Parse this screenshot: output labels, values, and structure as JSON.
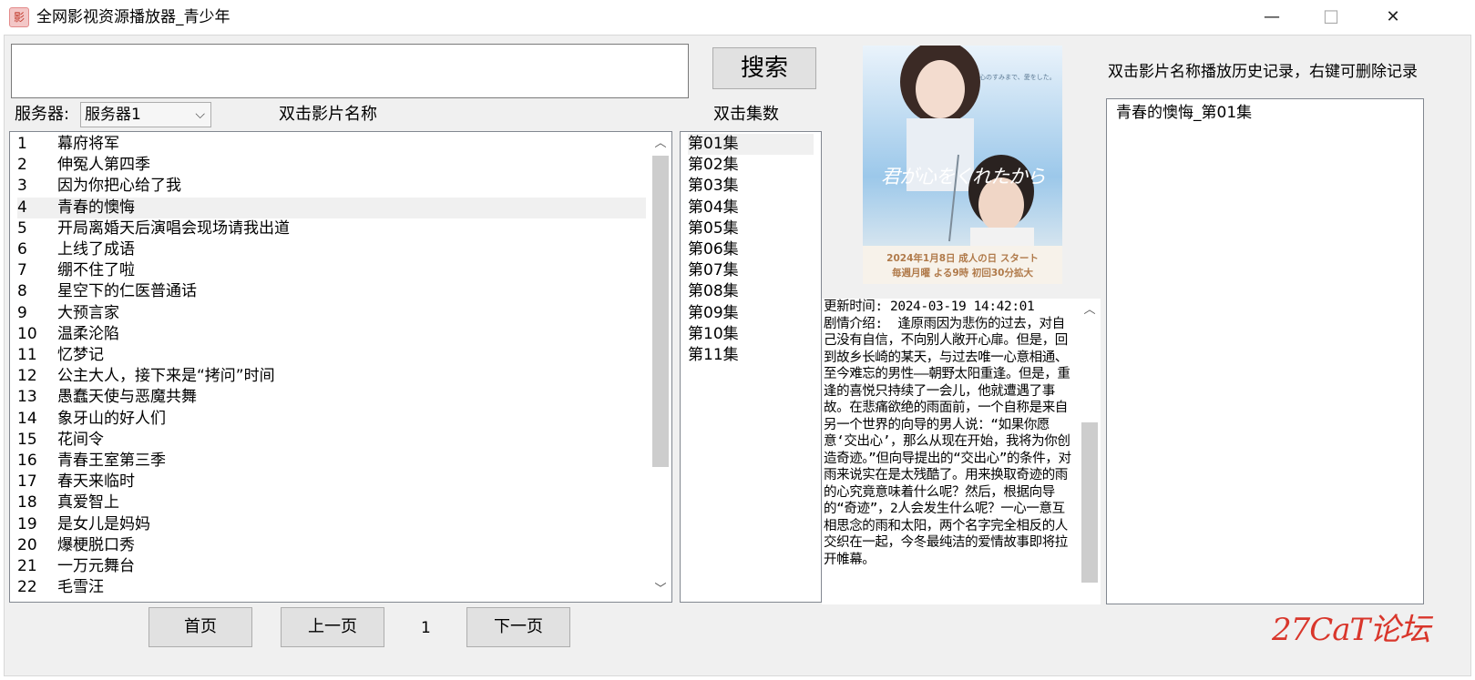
{
  "window": {
    "title": "全网影视资源播放器_青少年",
    "icon": "app-logo-icon",
    "controls": {
      "minimize": "—",
      "maximize": "☐",
      "close": "✕"
    }
  },
  "search": {
    "value": "",
    "button_label": "搜索"
  },
  "server": {
    "label": "服务器:",
    "selected": "服务器1"
  },
  "movie_list": {
    "header": "双击影片名称",
    "selected_index": 3,
    "items": [
      {
        "num": "1",
        "title": "幕府将军"
      },
      {
        "num": "2",
        "title": "伸冤人第四季"
      },
      {
        "num": "3",
        "title": "因为你把心给了我"
      },
      {
        "num": "4",
        "title": "青春的懊悔"
      },
      {
        "num": "5",
        "title": "开局离婚天后演唱会现场请我出道"
      },
      {
        "num": "6",
        "title": "上线了成语"
      },
      {
        "num": "7",
        "title": "绷不住了啦"
      },
      {
        "num": "8",
        "title": "星空下的仁医普通话"
      },
      {
        "num": "9",
        "title": "大预言家"
      },
      {
        "num": "10",
        "title": "温柔沦陷"
      },
      {
        "num": "11",
        "title": "忆梦记"
      },
      {
        "num": "12",
        "title": "公主大人，接下来是“拷问”时间"
      },
      {
        "num": "13",
        "title": "愚蠢天使与恶魔共舞"
      },
      {
        "num": "14",
        "title": "象牙山的好人们"
      },
      {
        "num": "15",
        "title": "花间令"
      },
      {
        "num": "16",
        "title": "青春王室第三季"
      },
      {
        "num": "17",
        "title": "春天来临时"
      },
      {
        "num": "18",
        "title": "真爱智上"
      },
      {
        "num": "19",
        "title": "是女儿是妈妈"
      },
      {
        "num": "20",
        "title": "爆梗脱口秀"
      },
      {
        "num": "21",
        "title": "一万元舞台"
      },
      {
        "num": "22",
        "title": "毛雪汪"
      }
    ]
  },
  "episode_list": {
    "header": "双击集数",
    "selected_index": 0,
    "items": [
      "第01集",
      "第02集",
      "第03集",
      "第04集",
      "第05集",
      "第06集",
      "第07集",
      "第08集",
      "第09集",
      "第10集",
      "第11集"
    ]
  },
  "poster": {
    "title_text": "君が心をくれたから",
    "tagline": "心のすみまで、愛をした。",
    "line1": "2024年1月8日 成人の日 スタート",
    "line2": "毎週月曜 よる9時 初回30分拡大"
  },
  "description": {
    "text": "更新时间: 2024-03-19 14:42:01\n剧情介绍:  逢原雨因为悲伤的过去，对自己没有自信，不向别人敞开心扉。但是，回到故乡长崎的某天，与过去唯一心意相通、至今难忘的男性——朝野太阳重逢。但是，重逢的喜悦只持续了一会儿，他就遭遇了事故。在悲痛欲绝的雨面前，一个自称是来自另一个世界的向导的男人说：“如果你愿意‘交出心’，那么从现在开始，我将为你创造奇迹。”但向导提出的“交出心”的条件，对雨来说实在是太残酷了。用来换取奇迹的雨的心究竟意味着什么呢？然后，根据向导的“奇迹”，2人会发生什么呢？一心一意互相思念的雨和太阳，两个名字完全相反的人交织在一起，今冬最纯洁的爱情故事即将拉开帷幕。"
  },
  "history": {
    "header": "双击影片名称播放历史记录，右键可删除记录",
    "items": [
      "青春的懊悔_第01集"
    ]
  },
  "pagination": {
    "first": "首页",
    "prev": "上一页",
    "current": "1",
    "next": "下一页"
  },
  "watermark": "27CaT论坛"
}
